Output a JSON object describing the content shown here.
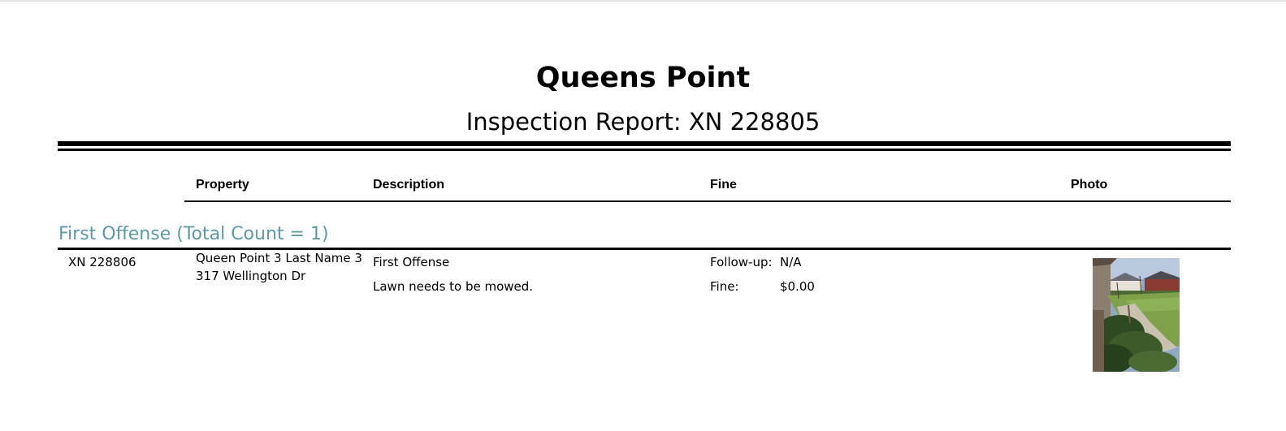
{
  "report": {
    "title": "Queens Point",
    "subtitle": "Inspection Report: XN 228805"
  },
  "columns": {
    "property": "Property",
    "description": "Description",
    "fine": "Fine",
    "photo": "Photo"
  },
  "group": {
    "heading": "First Offense (Total Count = 1)"
  },
  "record": {
    "id": "XN 228806",
    "owner": "Queen Point 3 Last Name 3",
    "address": "317 Wellington Dr",
    "offense": "First Offense",
    "description": "Lawn needs to be mowed.",
    "followup_label": "Follow-up:",
    "followup_value": "N/A",
    "fine_label": "Fine:",
    "fine_value": "$0.00",
    "photo_icon": "lawn-photo"
  }
}
